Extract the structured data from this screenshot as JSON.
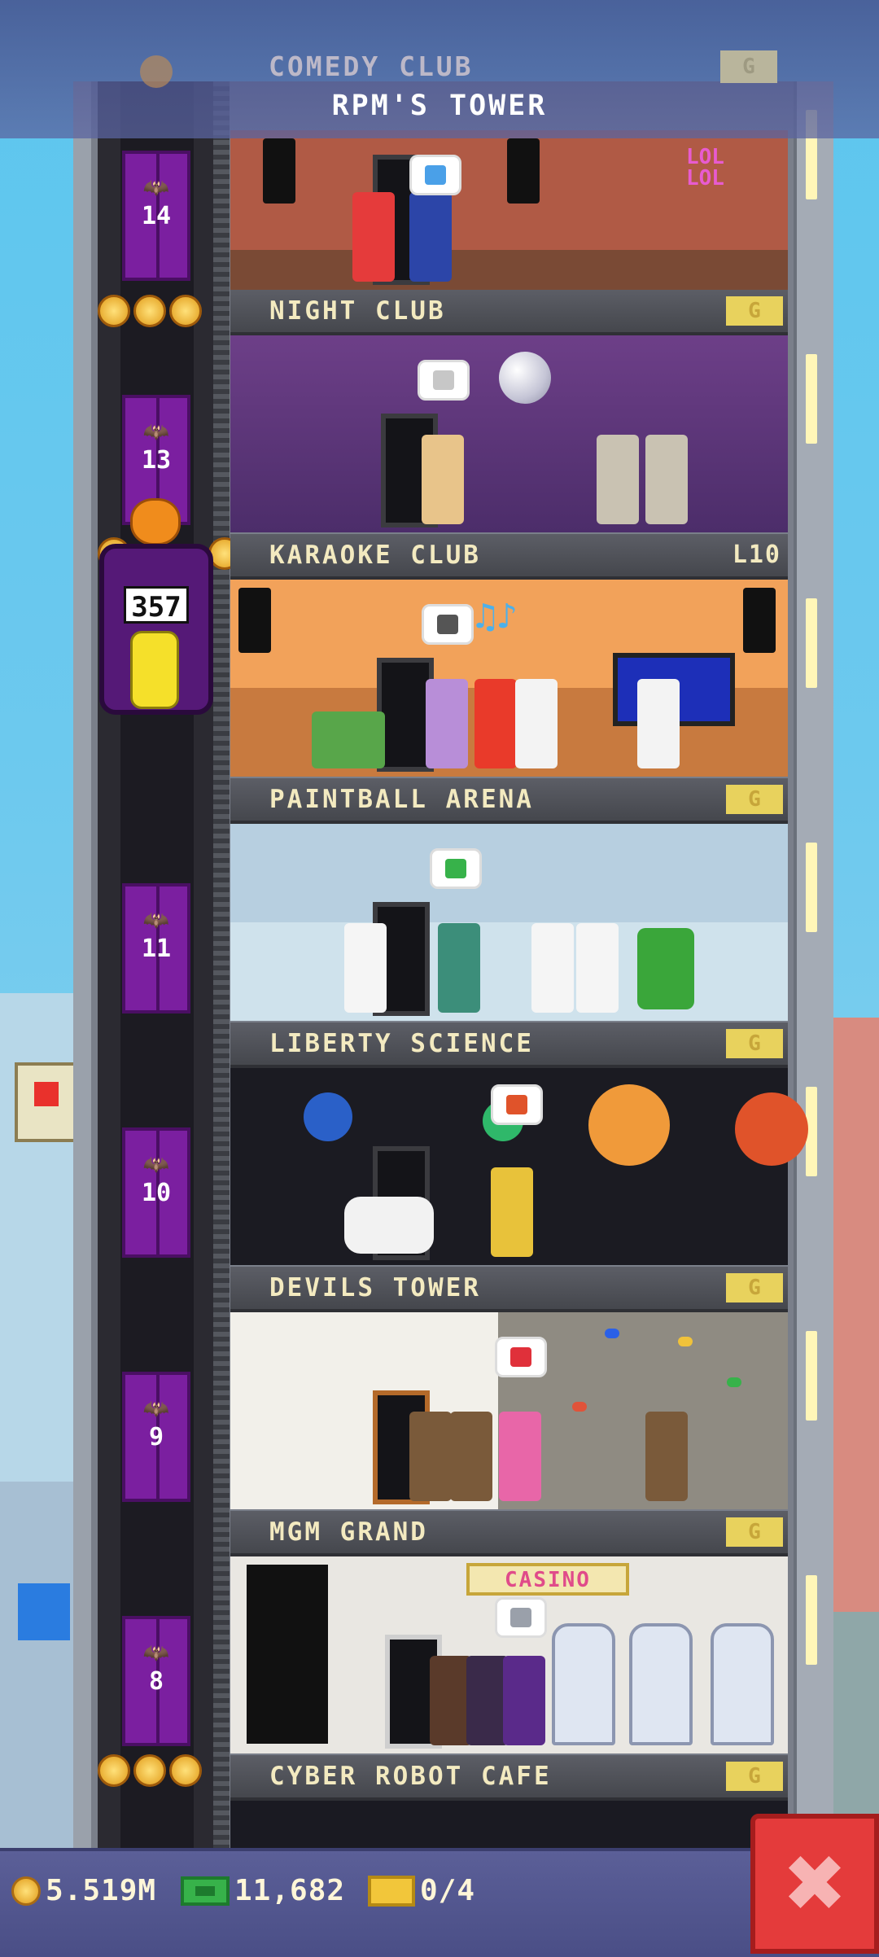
{
  "top_bar": {
    "partial_floor_name": "COMEDY CLUB",
    "partial_floor_badge": "G",
    "tower_name": "RPM'S TOWER"
  },
  "elevator": {
    "counter": "357",
    "floor_numbers": [
      "14",
      "13",
      "11",
      "10",
      "9",
      "8"
    ]
  },
  "floors": [
    {
      "name": "NIGHT CLUB",
      "badge": "G"
    },
    {
      "name": "KARAOKE CLUB",
      "level": "L10"
    },
    {
      "name": "PAINTBALL ARENA",
      "badge": "G"
    },
    {
      "name": "LIBERTY SCIENCE",
      "badge": "G"
    },
    {
      "name": "DEVILS TOWER",
      "badge": "G"
    },
    {
      "name": "MGM GRAND",
      "badge": "G"
    },
    {
      "name": "CYBER ROBOT CAFE",
      "badge": "G"
    }
  ],
  "rooms": {
    "comedy_sign": "LOL LOL",
    "casino_sign": "CASINO"
  },
  "stats": {
    "coins": "5.519M",
    "bux": "11,682",
    "tickets": "0/4"
  },
  "icons": {
    "close": "close-icon",
    "coin": "coin-icon",
    "bux": "bux-icon",
    "ticket": "ticket-icon"
  },
  "colors": {
    "accent_close": "#e43b3b",
    "elevator_purple": "#7b1fa0",
    "floor_label": "#f3eac0",
    "badge_gold": "#e8d25d"
  }
}
